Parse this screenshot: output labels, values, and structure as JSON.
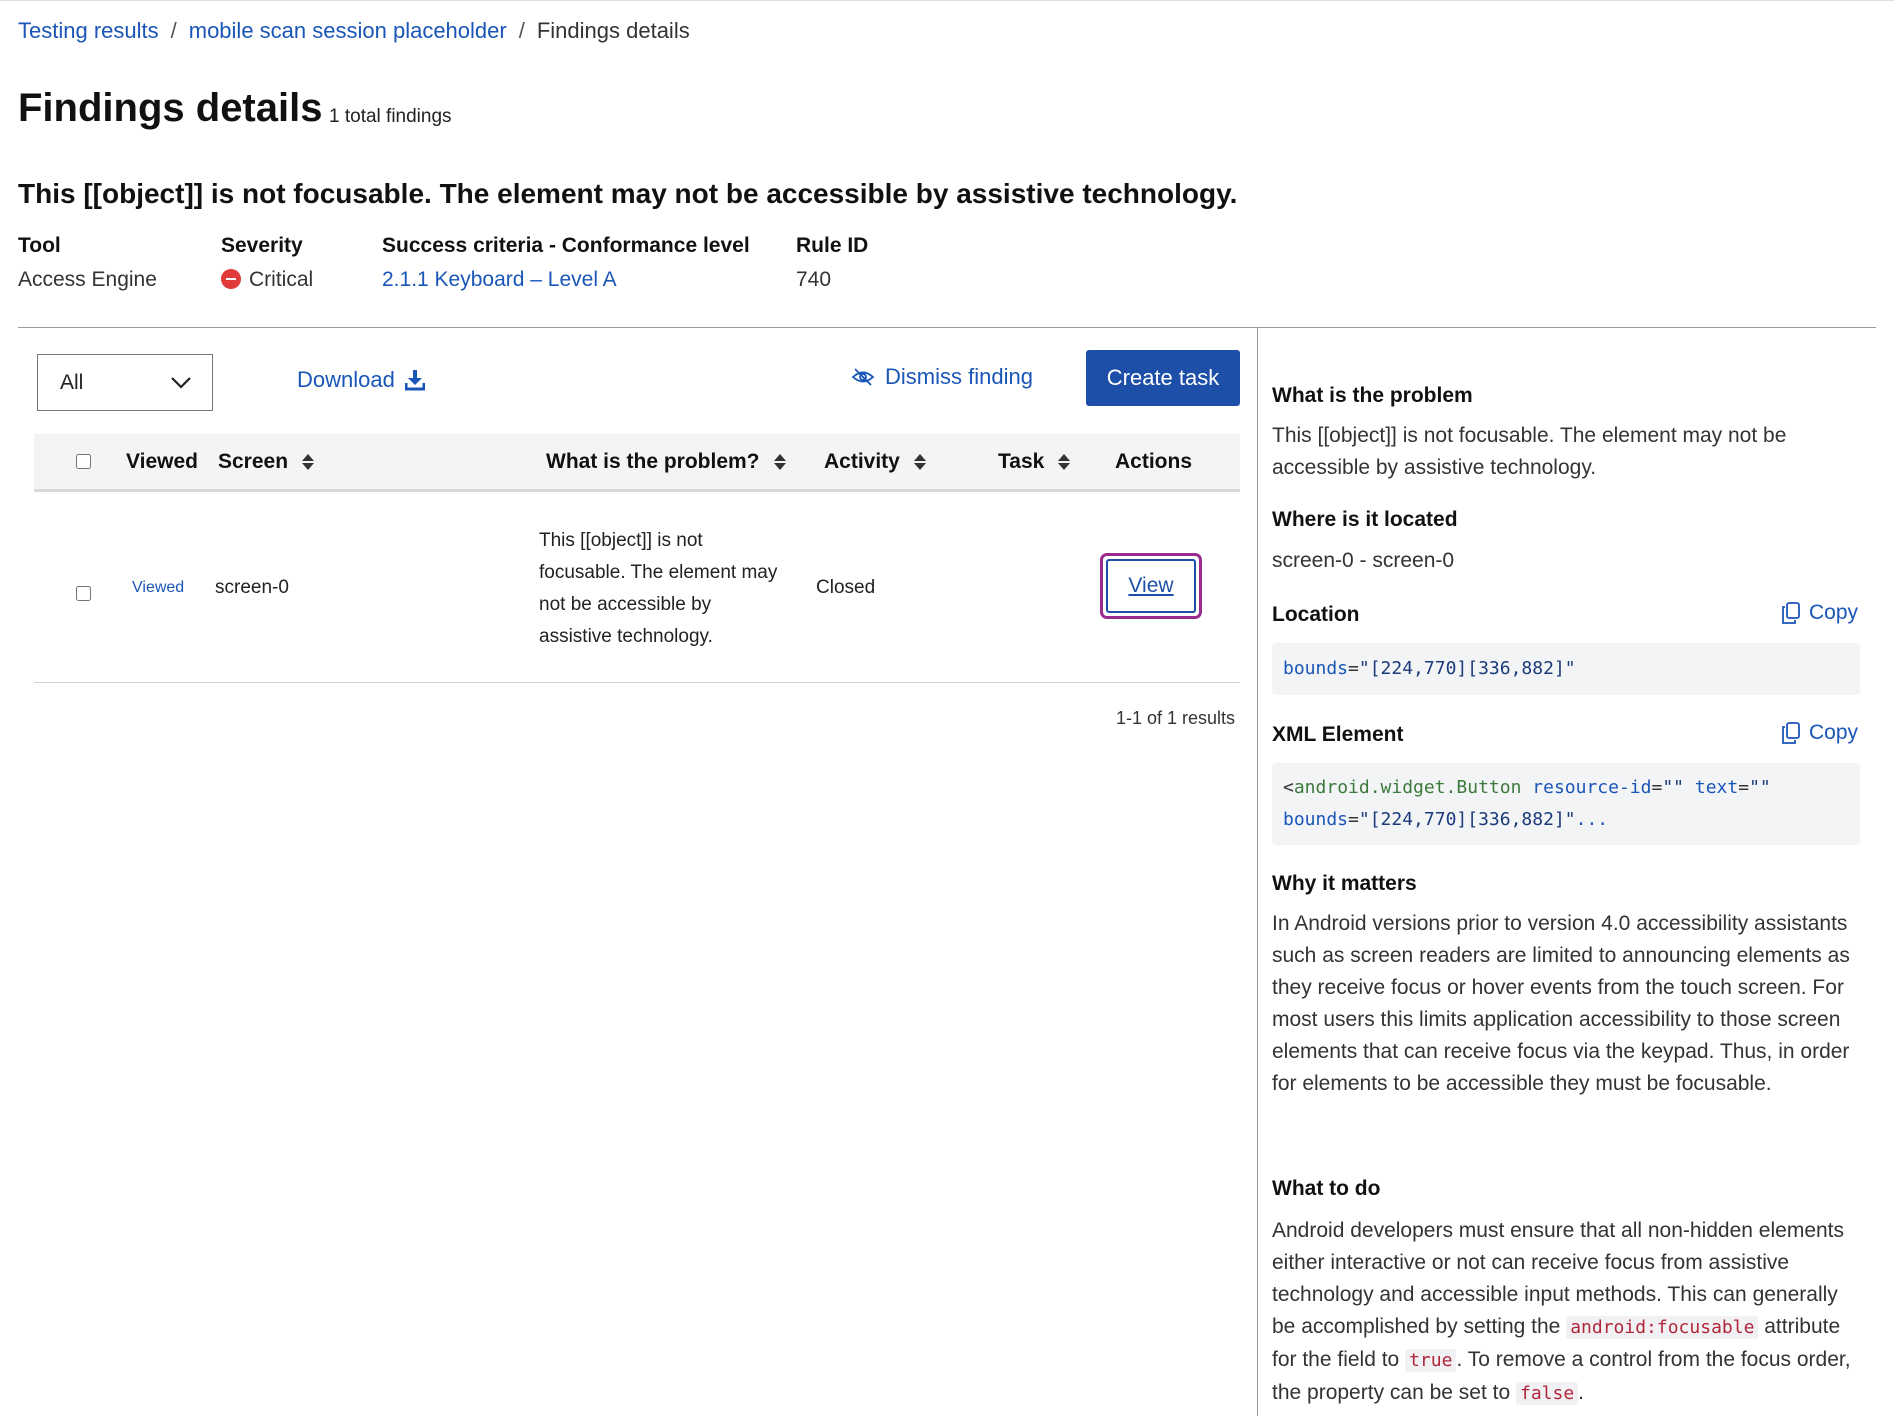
{
  "breadcrumb": {
    "items": [
      "Testing results",
      "mobile scan session placeholder"
    ],
    "separator": "/",
    "current": "Findings details"
  },
  "page": {
    "title": "Findings details",
    "total_findings": "1 total findings",
    "finding_title": "This [[object]] is not focusable. The element may not be accessible by assistive technology."
  },
  "meta": {
    "tool_label": "Tool",
    "tool_value": "Access Engine",
    "severity_label": "Severity",
    "severity_value": "Critical",
    "criteria_label": "Success criteria - Conformance level",
    "criteria_value": "2.1.1 Keyboard – Level A",
    "rule_label": "Rule ID",
    "rule_value": "740"
  },
  "toolbar": {
    "filter_value": "All",
    "download_label": "Download",
    "dismiss_label": "Dismiss finding",
    "create_task_label": "Create task"
  },
  "table": {
    "headers": {
      "viewed": "Viewed",
      "screen": "Screen",
      "problem": "What is the problem?",
      "activity": "Activity",
      "task": "Task",
      "actions": "Actions"
    },
    "rows": [
      {
        "viewed": "Viewed",
        "screen": "screen-0",
        "problem": "This [[object]] is not focusable. The element may not be accessible by assistive technology.",
        "activity": "Closed",
        "task": "",
        "action": "View"
      }
    ],
    "results": "1-1 of 1 results"
  },
  "panel": {
    "problem_heading": "What is the problem",
    "problem_text": "This [[object]] is not focusable. The element may not be accessible by assistive technology.",
    "located_heading": "Where is it located",
    "located_text": "screen-0 - screen-0",
    "location_heading": "Location",
    "copy_label": "Copy",
    "location_attr": "bounds",
    "location_value": "\"[224,770][336,882]\"",
    "xml_heading": "XML Element",
    "xml": {
      "open": "<",
      "tag": "android.widget.Button",
      "attr1": "resource-id",
      "val1": "\"\"",
      "attr2": "text",
      "val2": "\"\"",
      "attr3": "bounds",
      "val3": "\"[224,770][336,882]\"",
      "ellipsis": "..."
    },
    "why_heading": "Why it matters",
    "why_text": "In Android versions prior to version 4.0 accessibility assistants such as screen readers are limited to announcing elements as they receive focus or hover events from the touch screen. For most users this limits application accessibility to those screen elements that can receive focus via the keypad. Thus, in order for elements to be accessible they must be focusable.",
    "todo_heading": "What to do",
    "todo_part1": "Android developers must ensure that all non-hidden elements either interactive or not can receive focus from assistive technology and accessible input methods. This can generally be accomplished by setting the ",
    "todo_code1": "android:focusable",
    "todo_part2": " attribute for the field to ",
    "todo_code2": "true",
    "todo_part3": ". To remove a control from the focus order, the property can be set to ",
    "todo_code3": "false",
    "todo_part4": "."
  },
  "colors": {
    "link": "#1a56b8",
    "primary_button": "#1d4fa8",
    "critical": "#e03a3a",
    "focus_ring": "#9b2a8e"
  },
  "icons": {
    "filter": "chevron-down-icon",
    "download": "download-icon",
    "dismiss": "eye-slash-icon",
    "copy": "copy-icon",
    "severity": "critical-icon",
    "sort": "sort-icon"
  }
}
